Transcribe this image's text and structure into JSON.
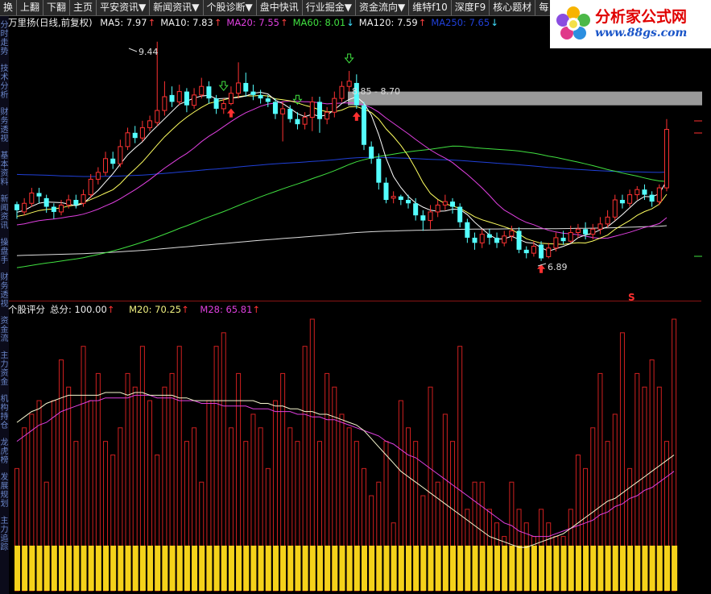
{
  "toolbar": {
    "buttons": [
      "换",
      "上翻",
      "下翻",
      "主页",
      "平安资讯▼",
      "新闻资讯▼",
      "个股诊断▼",
      "盘中快讯",
      "行业掘金▼",
      "资金流向▼",
      "维特f10",
      "深度F9",
      "核心题材",
      "每"
    ]
  },
  "logo": {
    "brand": "分析家公式网",
    "url": "www.88gs.com"
  },
  "sidebar": {
    "tabs": [
      "分时走势",
      "技术分析",
      "财务透视",
      "基本资料",
      "新闻资讯",
      "操盘手",
      "财务透视",
      "资金流",
      "主力资金",
      "机构持仓",
      "龙虎榜",
      "发展规划",
      "主力追踪"
    ]
  },
  "price_panel": {
    "stock_label": "万里扬(日线,前复权)",
    "ma_labels": [
      {
        "text": "MA5: 7.97",
        "color": "#f0f0f0",
        "arrow": "↑",
        "arrow_color": "#ff4040"
      },
      {
        "text": "MA10: 7.83",
        "color": "#f0f0f0",
        "arrow": "↑",
        "arrow_color": "#ff4040"
      },
      {
        "text": "MA20: 7.55",
        "color": "#e040e0",
        "arrow": "↑",
        "arrow_color": "#ff4040"
      },
      {
        "text": "MA60: 8.01",
        "color": "#40e040",
        "arrow": "↓",
        "arrow_color": "#40e0ff"
      },
      {
        "text": "MA120: 7.59",
        "color": "#f0f0f0",
        "arrow": "↑",
        "arrow_color": "#ff4040"
      },
      {
        "text": "MA250: 7.65",
        "color": "#2040d8",
        "arrow": "↓",
        "arrow_color": "#40e0ff"
      }
    ],
    "annotations": {
      "high": "9.44",
      "low": "6.89",
      "range": "8.85 - 8.70",
      "s_marker": "S"
    }
  },
  "score_panel": {
    "title": "个股评分",
    "total_label": "总分: 100.00",
    "m20_label": "M20: 70.25",
    "m28_label": "M28: 65.81"
  },
  "chart_data": {
    "type": "candlestick",
    "title": "万里扬(日线,前复权)",
    "ohlc": [
      [
        7.55,
        7.48,
        7.58,
        7.38
      ],
      [
        7.46,
        7.56,
        7.62,
        7.42
      ],
      [
        7.56,
        7.68,
        7.74,
        7.52
      ],
      [
        7.68,
        7.64,
        7.74,
        7.56
      ],
      [
        7.62,
        7.52,
        7.66,
        7.45
      ],
      [
        7.52,
        7.46,
        7.56,
        7.38
      ],
      [
        7.46,
        7.54,
        7.6,
        7.42
      ],
      [
        7.54,
        7.6,
        7.66,
        7.5
      ],
      [
        7.6,
        7.54,
        7.66,
        7.5
      ],
      [
        7.56,
        7.66,
        7.72,
        7.52
      ],
      [
        7.66,
        7.84,
        7.9,
        7.62
      ],
      [
        7.84,
        7.92,
        7.98,
        7.78
      ],
      [
        7.92,
        8.08,
        8.16,
        7.88
      ],
      [
        8.08,
        8.02,
        8.16,
        7.96
      ],
      [
        8.02,
        8.22,
        8.3,
        7.98
      ],
      [
        8.22,
        8.38,
        8.44,
        8.18
      ],
      [
        8.38,
        8.32,
        8.46,
        8.26
      ],
      [
        8.32,
        8.44,
        8.52,
        8.28
      ],
      [
        8.44,
        8.52,
        8.58,
        8.4
      ],
      [
        8.5,
        8.64,
        9.44,
        8.46
      ],
      [
        8.64,
        8.8,
        8.98,
        8.58
      ],
      [
        8.82,
        8.74,
        8.92,
        8.68
      ],
      [
        8.74,
        8.86,
        8.94,
        8.7
      ],
      [
        8.86,
        8.7,
        8.9,
        8.62
      ],
      [
        8.7,
        8.82,
        8.9,
        8.66
      ],
      [
        8.82,
        8.92,
        9.02,
        8.78
      ],
      [
        8.92,
        8.78,
        8.98,
        8.72
      ],
      [
        8.78,
        8.66,
        8.82,
        8.6
      ],
      [
        8.66,
        8.72,
        8.78,
        8.6
      ],
      [
        8.72,
        8.84,
        8.92,
        8.7
      ],
      [
        8.84,
        8.96,
        9.2,
        8.78
      ],
      [
        8.96,
        8.86,
        9.08,
        8.8
      ],
      [
        8.86,
        8.82,
        8.94,
        8.76
      ],
      [
        8.82,
        8.78,
        8.88,
        8.72
      ],
      [
        8.78,
        8.74,
        8.82,
        8.68
      ],
      [
        8.74,
        8.6,
        8.78,
        8.54
      ],
      [
        8.6,
        8.66,
        8.74,
        8.28
      ],
      [
        8.66,
        8.54,
        8.7,
        8.5
      ],
      [
        8.54,
        8.48,
        8.62,
        8.42
      ],
      [
        8.48,
        8.56,
        8.62,
        8.42
      ],
      [
        8.56,
        8.74,
        8.8,
        8.4
      ],
      [
        8.74,
        8.54,
        8.8,
        8.38
      ],
      [
        8.54,
        8.62,
        8.68,
        8.48
      ],
      [
        8.62,
        8.78,
        8.86,
        8.56
      ],
      [
        8.78,
        8.92,
        8.98,
        8.74
      ],
      [
        8.92,
        8.98,
        9.1,
        8.86
      ],
      [
        8.96,
        8.7,
        9.06,
        8.66
      ],
      [
        8.7,
        8.24,
        8.74,
        8.18
      ],
      [
        8.22,
        8.08,
        8.28,
        8.02
      ],
      [
        8.08,
        7.8,
        8.14,
        7.72
      ],
      [
        7.8,
        7.6,
        7.86,
        7.56
      ],
      [
        7.62,
        7.64,
        7.7,
        7.56
      ],
      [
        7.64,
        7.6,
        7.66,
        7.54
      ],
      [
        7.6,
        7.56,
        7.66,
        7.5
      ],
      [
        7.56,
        7.42,
        7.62,
        7.36
      ],
      [
        7.42,
        7.36,
        7.48,
        7.24
      ],
      [
        7.36,
        7.46,
        7.54,
        7.26
      ],
      [
        7.46,
        7.54,
        7.6,
        7.4
      ],
      [
        7.54,
        7.58,
        7.66,
        7.48
      ],
      [
        7.58,
        7.52,
        7.62,
        7.44
      ],
      [
        7.52,
        7.34,
        7.56,
        7.28
      ],
      [
        7.34,
        7.16,
        7.38,
        7.1
      ],
      [
        7.16,
        7.1,
        7.22,
        7.02
      ],
      [
        7.1,
        7.2,
        7.26,
        7.04
      ],
      [
        7.2,
        7.16,
        7.26,
        7.08
      ],
      [
        7.16,
        7.1,
        7.22,
        7.04
      ],
      [
        7.1,
        7.18,
        7.24,
        7.06
      ],
      [
        7.18,
        7.24,
        7.3,
        7.12
      ],
      [
        7.24,
        7.02,
        7.28,
        6.98
      ],
      [
        7.02,
        6.98,
        7.06,
        6.92
      ],
      [
        6.98,
        7.06,
        7.12,
        6.94
      ],
      [
        7.08,
        6.92,
        7.12,
        6.89
      ],
      [
        6.94,
        7.04,
        7.1,
        6.92
      ],
      [
        7.04,
        7.16,
        7.22,
        7.0
      ],
      [
        7.16,
        7.12,
        7.24,
        7.08
      ],
      [
        7.12,
        7.22,
        7.3,
        7.1
      ],
      [
        7.22,
        7.26,
        7.32,
        7.16
      ],
      [
        7.26,
        7.2,
        7.34,
        7.14
      ],
      [
        7.2,
        7.26,
        7.32,
        7.14
      ],
      [
        7.26,
        7.32,
        7.4,
        7.2
      ],
      [
        7.32,
        7.4,
        7.48,
        7.28
      ],
      [
        7.4,
        7.6,
        7.66,
        7.36
      ],
      [
        7.6,
        7.56,
        7.66,
        7.5
      ],
      [
        7.56,
        7.66,
        7.72,
        7.52
      ],
      [
        7.66,
        7.72,
        7.76,
        7.6
      ],
      [
        7.72,
        7.66,
        7.78,
        7.6
      ],
      [
        7.66,
        7.58,
        7.7,
        7.52
      ],
      [
        7.58,
        7.74,
        7.78,
        7.54
      ],
      [
        7.74,
        8.42,
        8.54,
        7.7
      ]
    ],
    "ylim": [
      6.55,
      9.55
    ],
    "markers": {
      "buy": [
        43,
        46,
        71,
        73
      ],
      "sell": [
        37,
        49,
        61
      ],
      "red_up": [
        29,
        46,
        71
      ],
      "green_down": [
        28,
        38,
        45
      ]
    },
    "score_bars": [
      45,
      60,
      65,
      70,
      40,
      70,
      85,
      75,
      55,
      90,
      70,
      80,
      55,
      50,
      60,
      80,
      75,
      90,
      70,
      50,
      75,
      80,
      90,
      55,
      60,
      40,
      70,
      90,
      95,
      60,
      80,
      55,
      65,
      60,
      45,
      70,
      80,
      60,
      55,
      90,
      100,
      55,
      80,
      75,
      65,
      60,
      55,
      45,
      35,
      40,
      55,
      25,
      70,
      60,
      55,
      35,
      75,
      40,
      65,
      55,
      90,
      30,
      40,
      40,
      30,
      25,
      20,
      40,
      30,
      25,
      20,
      30,
      25,
      20,
      20,
      30,
      50,
      45,
      60,
      80,
      55,
      65,
      95,
      45,
      80,
      75,
      85,
      75,
      55,
      100
    ],
    "score_ylim": [
      0,
      100
    ],
    "m20_line": [
      62,
      64,
      66,
      67,
      69,
      70,
      71,
      72,
      72,
      72,
      72,
      72,
      73,
      73,
      73,
      72,
      73,
      73,
      72,
      72,
      72,
      72,
      71,
      71,
      70,
      70,
      70,
      70,
      70,
      70,
      70,
      70,
      70,
      69,
      69,
      68,
      68,
      67,
      67,
      66,
      66,
      65,
      65,
      64,
      63,
      62,
      61,
      59,
      56,
      53,
      50,
      47,
      44,
      42,
      40,
      38,
      36,
      34,
      32,
      30,
      28,
      26,
      24,
      22,
      20,
      19,
      18,
      17,
      16,
      16,
      17,
      18,
      19,
      20,
      21,
      23,
      25,
      27,
      29,
      31,
      33,
      34,
      36,
      38,
      40,
      42,
      44,
      46,
      48,
      50
    ],
    "m28_line": [
      55,
      57,
      59,
      61,
      62,
      64,
      66,
      67,
      68,
      69,
      70,
      70,
      71,
      71,
      71,
      71,
      72,
      72,
      72,
      71,
      71,
      71,
      70,
      70,
      70,
      69,
      69,
      69,
      68,
      68,
      68,
      68,
      67,
      67,
      67,
      66,
      66,
      66,
      65,
      65,
      64,
      64,
      63,
      63,
      62,
      61,
      60,
      59,
      58,
      57,
      55,
      54,
      52,
      50,
      49,
      47,
      45,
      43,
      41,
      39,
      37,
      35,
      33,
      31,
      29,
      27,
      25,
      24,
      22,
      21,
      20,
      20,
      20,
      21,
      22,
      23,
      24,
      25,
      26,
      28,
      29,
      31,
      32,
      34,
      35,
      37,
      38,
      40,
      42,
      44
    ],
    "colors": {
      "up": "#ff3232",
      "down": "#54ffff",
      "ma5": "#ffffff",
      "ma10": "#ffff60",
      "ma20": "#e040e0",
      "ma60": "#40e040",
      "ma120": "#dddddd",
      "ma250": "#2040d8"
    }
  }
}
